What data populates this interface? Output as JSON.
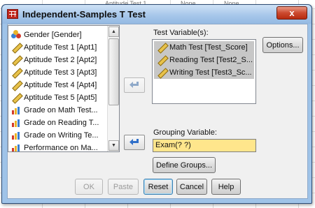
{
  "background": {
    "cells": [
      "Aptitude Test 1",
      "None",
      "None"
    ]
  },
  "dialog": {
    "title": "Independent-Samples T Test",
    "close_glyph": "x"
  },
  "source_list": {
    "items": [
      {
        "label": "Gender [Gender]",
        "icon": "nominal-variable-icon"
      },
      {
        "label": "Aptitude Test 1 [Apt1]",
        "icon": "scale-variable-icon"
      },
      {
        "label": "Aptitude Test 2 [Apt2]",
        "icon": "scale-variable-icon"
      },
      {
        "label": "Aptitude Test 3 [Apt3]",
        "icon": "scale-variable-icon"
      },
      {
        "label": "Aptitude Test 4 [Apt4]",
        "icon": "scale-variable-icon"
      },
      {
        "label": "Aptitude Test 5 [Apt5]",
        "icon": "scale-variable-icon"
      },
      {
        "label": "Grade on Math Test...",
        "icon": "ordinal-variable-icon"
      },
      {
        "label": "Grade on Reading T...",
        "icon": "ordinal-variable-icon"
      },
      {
        "label": "Grade on Writing Te...",
        "icon": "ordinal-variable-icon"
      },
      {
        "label": "Performance on Ma...",
        "icon": "ordinal-variable-icon"
      }
    ]
  },
  "test_variables": {
    "label": "Test Variable(s):",
    "items": [
      {
        "label": "Math Test [Test_Score]",
        "icon": "scale-variable-icon"
      },
      {
        "label": "Reading Test [Test2_S...",
        "icon": "scale-variable-icon"
      },
      {
        "label": "Writing Test [Test3_Sc...",
        "icon": "scale-variable-icon"
      }
    ]
  },
  "grouping": {
    "label": "Grouping Variable:",
    "value": "Exam(? ?)"
  },
  "buttons": {
    "options": "Options...",
    "define_groups": "Define Groups...",
    "ok": "OK",
    "paste": "Paste",
    "reset": "Reset",
    "cancel": "Cancel",
    "help": "Help"
  },
  "colors": {
    "title_bar": "#a7c7ea",
    "grouping_field_bg": "#ffe68c",
    "selected_item_bg": "#c7c7c7",
    "arrow_blue": "#2f6fc9"
  }
}
